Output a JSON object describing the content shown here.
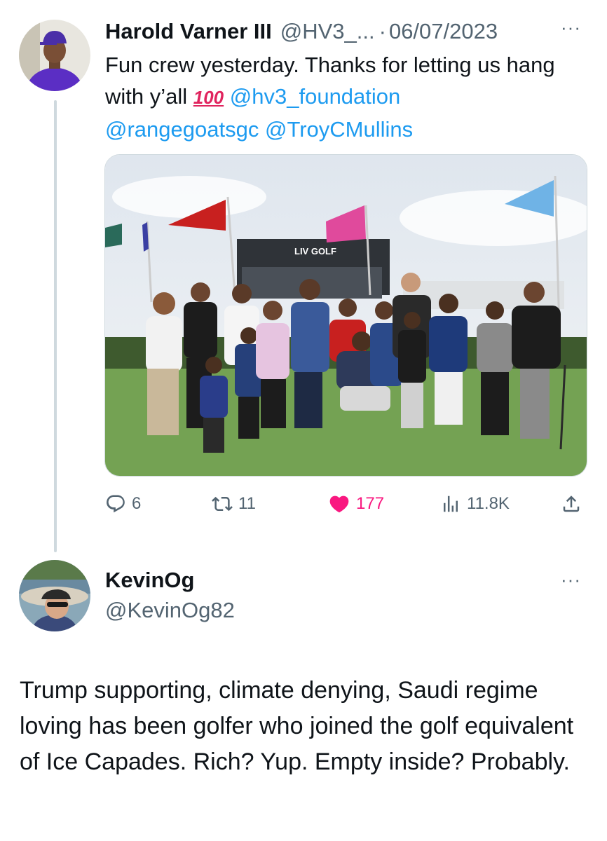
{
  "tweet": {
    "display_name": "Harold Varner III",
    "handle": "@HV3_...",
    "separator": "·",
    "date": "06/07/2023",
    "more_label": "···",
    "text_part1": "Fun crew yesterday. Thanks for letting us hang with y’all ",
    "emoji_hundred": "100",
    "mention_foundation": "@hv3_foundation",
    "mention_rangegoats": "@rangegoatsgc",
    "mention_troy": "@TroyCMullins",
    "photo_sign_text": "LIV GOLF",
    "stats": {
      "replies": "6",
      "retweets": "11",
      "likes": "177",
      "views": "11.8K"
    }
  },
  "reply": {
    "display_name": "KevinOg",
    "handle": "@KevinOg82",
    "more_label": "···",
    "text": "Trump supporting, climate denying, Saudi regime loving has been golfer who joined the golf equivalent of Ice Capades. Rich? Yup. Empty inside? Probably."
  },
  "colors": {
    "link": "#1d9bf0",
    "like": "#f91880",
    "secondary_text": "#536471",
    "thread_line": "#cfd9de"
  },
  "icons": [
    "reply-icon",
    "retweet-icon",
    "like-heart-icon",
    "views-chart-icon",
    "share-icon",
    "more-dots-icon"
  ]
}
